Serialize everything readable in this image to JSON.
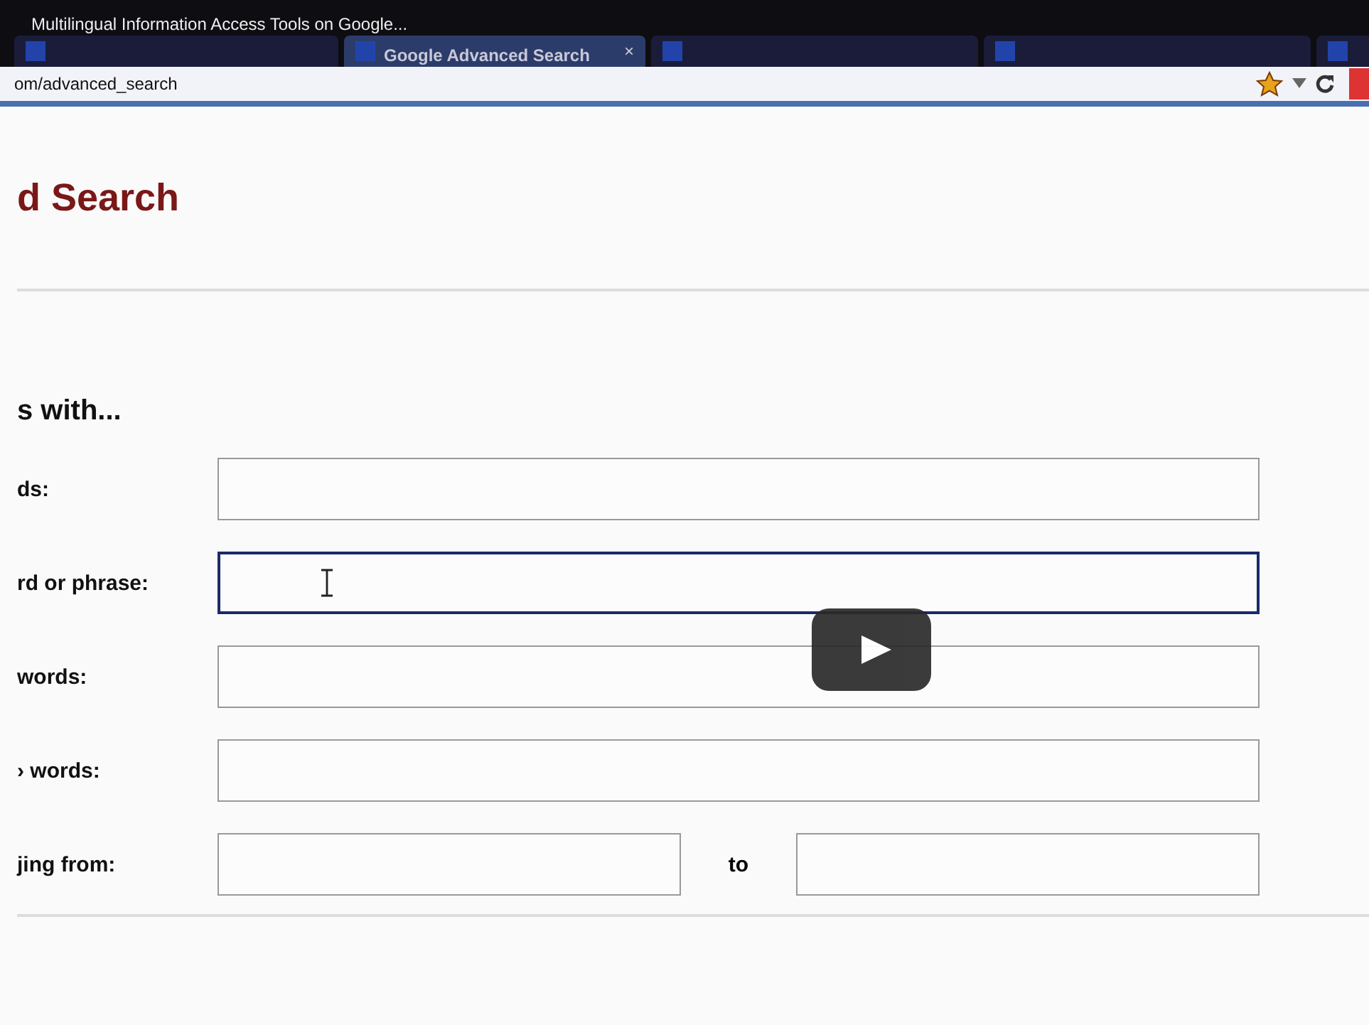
{
  "video_title": "Multilingual Information Access Tools on Google...",
  "tabs": [
    {
      "selected": false
    },
    {
      "label": "Google Advanced Search",
      "selected": true,
      "close": "×"
    },
    {
      "selected": false
    },
    {
      "selected": false
    },
    {
      "selected": false
    }
  ],
  "address_bar": {
    "url": "om/advanced_search"
  },
  "page": {
    "heading": "d Search",
    "section_title": "s with...",
    "fields": [
      {
        "kind": "single",
        "label": "ds:",
        "focused": false
      },
      {
        "kind": "single",
        "label": "rd or phrase:",
        "focused": true
      },
      {
        "kind": "single",
        "label": "words:",
        "focused": false
      },
      {
        "kind": "single",
        "label": "› words:",
        "focused": false
      },
      {
        "kind": "range",
        "label": "jing from:",
        "to_label": "to",
        "focused": false
      }
    ]
  }
}
